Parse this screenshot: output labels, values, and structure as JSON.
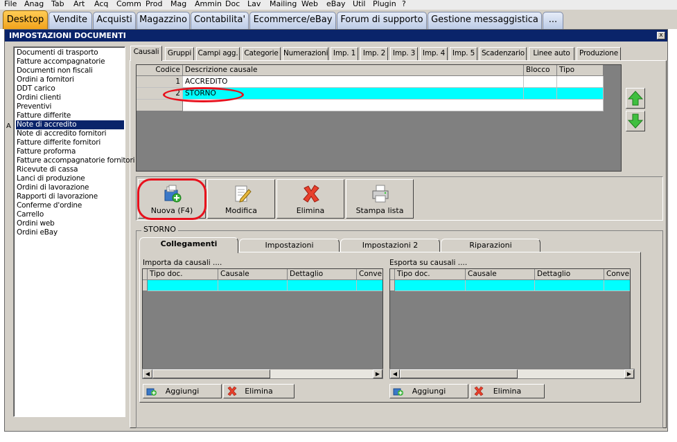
{
  "menu": [
    "File",
    "Anag",
    "Tab",
    "Art",
    "Acq",
    "Comm",
    "Prod",
    "Mag",
    "Ammin",
    "Doc",
    "Lav",
    "Mailing",
    "Web",
    "eBay",
    "Util",
    "Plugin",
    "?"
  ],
  "app_tabs": [
    "Desktop",
    "Vendite",
    "Acquisti",
    "Magazzino",
    "Contabilita'",
    "Ecommerce/eBay",
    "Forum di supporto",
    "Gestione messaggistica",
    "..."
  ],
  "window": {
    "title": "IMPOSTAZIONI DOCUMENTI",
    "close": "x"
  },
  "left_list": {
    "items": [
      "Documenti di trasporto",
      "Fatture accompagnatorie",
      "Documenti non fiscali",
      "Ordini a fornitori",
      "DDT carico",
      "Ordini clienti",
      "Preventivi",
      "Fatture differite",
      "Note di accredito",
      "Note di accredito fornitori",
      "Fatture differite fornitori",
      "Fatture proforma",
      "Fatture accompagnatorie fornitori",
      "Ricevute di cassa",
      "Lanci di produzione",
      "Ordini di lavorazione",
      "Rapporti di lavorazione",
      "Conferme d'ordine",
      "Carrello",
      "Ordini web",
      "Ordini eBay"
    ],
    "selected": "Note di accredito",
    "stray_char": "A"
  },
  "settings_tabs": [
    "Causali",
    "Gruppi",
    "Campi agg.",
    "Categorie",
    "Numerazioni",
    "Imp. 1",
    "Imp. 2",
    "Imp. 3",
    "Imp. 4",
    "Imp. 5",
    "Scadenzario",
    "Linee auto",
    "Produzione"
  ],
  "causali_grid": {
    "headers": [
      "Codice",
      "Descrizione causale",
      "Blocco",
      "Tipo"
    ],
    "rows": [
      {
        "codice": "1",
        "descrizione": "ACCREDITO",
        "blocco": "",
        "tipo": ""
      },
      {
        "codice": "2",
        "descrizione": "STORNO",
        "blocco": "",
        "tipo": ""
      }
    ]
  },
  "arrows": {
    "up_icon": "green-up-arrow",
    "down_icon": "green-down-arrow"
  },
  "toolbar": {
    "nuova": "Nuova (F4)",
    "modifica": "Modifica",
    "elimina": "Elimina",
    "stampa": "Stampa lista"
  },
  "group_title": "STORNO",
  "bottom_tabs": [
    "Collegamenti",
    "Impostazioni",
    "Impostazioni 2",
    "Riparazioni"
  ],
  "importa": {
    "label": "Importa da causali ....",
    "headers": [
      "Tipo doc.",
      "Causale",
      "Dettaglio",
      "Conver"
    ],
    "add": "Aggiungi",
    "delete": "Elimina"
  },
  "esporta": {
    "label": "Esporta su causali ....",
    "headers": [
      "Tipo doc.",
      "Causale",
      "Dettaglio",
      "Conversi"
    ],
    "add": "Aggiungi",
    "delete": "Elimina"
  },
  "colors": {
    "selection": "#0a246a",
    "cyan_row": "#00ffff",
    "highlight_oval": "#e8101c",
    "active_tab": "#f0a31c"
  }
}
